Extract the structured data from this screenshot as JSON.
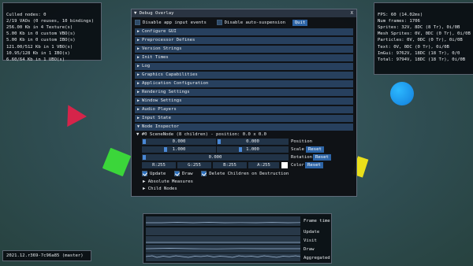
{
  "stats_left": {
    "lines": [
      "Culled nodes: 0",
      "2/19 VAOs (0 reuses, 10 bindings)",
      "256.00 Kb in 4 Texture(s)",
      "5.00 Kb in 0 custom VBO(s)",
      "5.00 Kb in 0 custom IBO(s)",
      "121.00/512 Kb in 1 VBO(s)",
      "10.95/128 Kb in 1 IBO(s)",
      "6.60/64 Kb in 1 UBO(s)"
    ]
  },
  "stats_right": {
    "lines": [
      "FPS: 60 (14.02ms)",
      "Num frames: 1706",
      "Sprites: 32V, 8DC (8 Tr), 0i/0B",
      "Mesh Sprites: 0V, 0DC (0 Tr), 0i/0B",
      "Particles: 0V, 0DC (0 Tr), 0i/0B",
      "Text: 0V, 0DC (0 Tr), 0i/0B",
      "ImGui: 9762V, 18DC (18 Tr), 0/0",
      "Total: 9794V, 18DC (18 Tr), 0i/0B"
    ]
  },
  "version": "2021.12.r369-7c96a85 (master)",
  "debug_window": {
    "title": "Debug Overlay",
    "close": "X",
    "disable_app_input_label": "Disable app input events",
    "disable_auto_suspension_label": "Disable auto-suspension",
    "quit_label": "Quit",
    "sections": [
      "Configure GUI",
      "Preprocessor Defines",
      "Version Strings",
      "Init Times",
      "Log",
      "Graphics Capabilities",
      "Application Configuration",
      "Rendering Settings",
      "Window Settings",
      "Audio Players",
      "Input State",
      "Node Inspector"
    ],
    "scene_node_label": "#0 SceneNode (8 children) - position: 0.0 x 0.0",
    "position": {
      "x": "0.000",
      "y": "0.000",
      "label": "Position"
    },
    "scale": {
      "x": "1.000",
      "y": "1.000",
      "label": "Scale",
      "reset": "Reset"
    },
    "rotation": {
      "value": "0.000",
      "label": "Rotation",
      "reset": "Reset"
    },
    "color": {
      "r": "R:255",
      "g": "G:255",
      "b": "B:255",
      "a": "A:255",
      "label": "Color",
      "reset": "Reset",
      "swatch": "#ffffff"
    },
    "update_label": "Update",
    "draw_label": "Draw",
    "delete_children_label": "Delete Children on Destruction",
    "absolute_measures_label": "Absolute Measures",
    "child_nodes_label": "Child Nodes",
    "accent_color": "#27405e"
  },
  "graph_panel": {
    "labels": [
      "Frame time",
      "Update",
      "Visit",
      "Draw",
      "Aggregated"
    ],
    "line_color": "#9fb9d6"
  },
  "scene_colors": {
    "triangle": "#d6244a",
    "square": "#3bd63a",
    "circle": "#1a8fe6",
    "yellow": "#eadf1a"
  }
}
